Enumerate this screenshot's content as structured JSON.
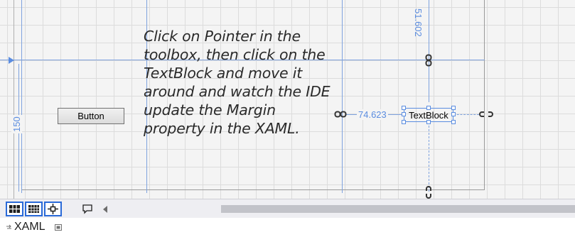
{
  "annotation": {
    "text": "Click on Pointer in the toolbox, then click on the TextBlock and move it around and watch the IDE update the Margin property in the XAML."
  },
  "designer": {
    "button_label": "Button",
    "textblock_label": "TextBlock",
    "margin_top_value": "51.602",
    "margin_left_value": "74.623",
    "margin_bottom_value": "150"
  },
  "toolbar": {
    "icons": [
      "grid-view-icon",
      "snap-grid-icon",
      "snap-lines-icon",
      "comment-icon",
      "scroll-left-arrow-icon"
    ]
  },
  "tabs": {
    "xaml_label": "XAML"
  },
  "colors": {
    "guide": "#7fa3df",
    "accent": "#2a6ad8",
    "canvas": "#f4f4f4"
  }
}
